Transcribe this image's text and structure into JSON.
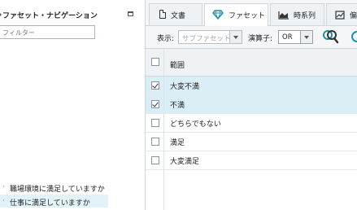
{
  "facet_navigation": {
    "title": "ファセット・ナビゲーション",
    "filter_placeholder": "フィルター",
    "items": [
      {
        "label": "職場環境に満足していますか"
      },
      {
        "label": "仕事に満足していますか",
        "selected": true
      }
    ]
  },
  "tabs": [
    {
      "label": "文書",
      "icon": "document-icon"
    },
    {
      "label": "ファセット",
      "icon": "diamond-icon",
      "active": true
    },
    {
      "label": "時系列",
      "icon": "area-chart-icon"
    },
    {
      "label": "偏",
      "icon": "chart-icon"
    }
  ],
  "toolbar": {
    "display_label": "表示:",
    "display_value": "サブファセット",
    "operator_label": "演算子:",
    "operator_value": "OR"
  },
  "table": {
    "header": "範囲",
    "rows": [
      {
        "label": "大変不満",
        "checked": true
      },
      {
        "label": "不満",
        "checked": true
      },
      {
        "label": "どちらでもない",
        "checked": false
      },
      {
        "label": "満足",
        "checked": false
      },
      {
        "label": "大変満足",
        "checked": false
      }
    ]
  },
  "colors": {
    "accent": "#1d8fb0",
    "selected_row": "#daeef7",
    "panel_bg": "#f4f6f8"
  }
}
